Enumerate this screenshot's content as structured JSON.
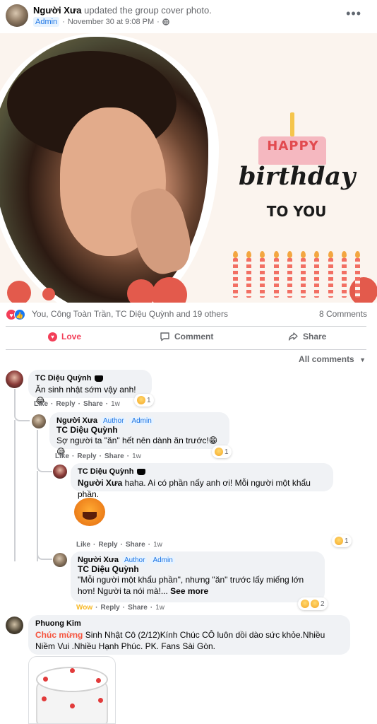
{
  "post": {
    "author": "Người Xưa",
    "action": "updated the group cover photo.",
    "badge": "Admin",
    "date": "November 30 at 9:08 PM",
    "dot": "·",
    "privacy_icon": "globe-icon",
    "more": "•••"
  },
  "cover": {
    "happy": "HAPPY",
    "birthday": "birthday",
    "to_you": "TO YOU"
  },
  "stats": {
    "names": "You, Công Toàn Trần, TC Diệu Quỳnh and 19 others",
    "comments": "8 Comments"
  },
  "actions": {
    "love": "Love",
    "comment": "Comment",
    "share": "Share"
  },
  "filter": {
    "label": "All comments"
  },
  "labels": {
    "like": "Like",
    "reply": "Reply",
    "share": "Share",
    "wow": "Wow",
    "author": "Author",
    "admin": "Admin",
    "see_more": "See more"
  },
  "comments": [
    {
      "name": "TC Diệu Quỳnh",
      "text": "Ăn sinh nhật sớm vậy anh! 😂",
      "time": "1w",
      "reactions": "1"
    },
    {
      "name": "Người Xưa",
      "reply_to": "TC Diệu Quỳnh",
      "text": "Sợ người ta \"ăn\" hết nên dành ăn trước!😁😅",
      "time": "1w",
      "reactions": "1"
    },
    {
      "name": "TC Diệu Quỳnh",
      "reply_to": "Người Xưa",
      "text": "haha. Ai có phần nấy anh ơi! Mỗi người một khẩu phần.",
      "time": "1w",
      "reactions": "1"
    },
    {
      "name": "Người Xưa",
      "reply_to": "TC Diệu Quỳnh",
      "text": "\"Mỗi người một khẩu phần\", nhưng \"ăn\" trước lấy miếng lớn hơn! Người ta nói mà!...",
      "time": "1w",
      "reactions": "2"
    },
    {
      "name": "Phuong Kim",
      "highlight": "Chúc mừng",
      "text": "Sinh Nhật Cô (2/12)Kính Chúc CÔ luôn dồi dào sức khỏe.Nhiều Niềm Vui .Nhiều Hạnh Phúc. PK. Fans Sài Gòn."
    }
  ],
  "colors": {
    "link_blue": "#1b74e4",
    "love_red": "#f33e58",
    "wow_yellow": "#f7b928",
    "bubble_bg": "#f0f2f5",
    "highlight": "#f5533d"
  }
}
